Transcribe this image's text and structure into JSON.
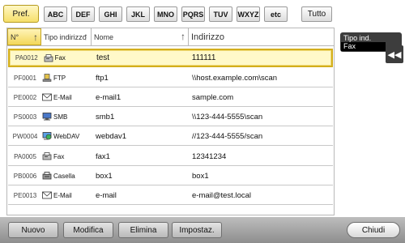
{
  "index_bar": {
    "pref_label": "Pref.",
    "tabs": [
      "ABC",
      "DEF",
      "GHI",
      "JKL",
      "MNO",
      "PQRS",
      "TUV",
      "WXYZ",
      "etc"
    ],
    "all_label": "Tutto"
  },
  "table": {
    "headers": {
      "number": "N°",
      "type": "Tipo indirizzo",
      "name": "Nome",
      "address": "Indirizzo"
    },
    "rows": [
      {
        "number": "PA0012",
        "type": "Fax",
        "type_icon": "fax-icon",
        "name": "test",
        "address": "111111"
      },
      {
        "number": "PF0001",
        "type": "FTP",
        "type_icon": "ftp-icon",
        "name": "ftp1",
        "address": "\\\\host.example.com\\scan"
      },
      {
        "number": "PE0002",
        "type": "E-Mail",
        "type_icon": "email-icon",
        "name": "e-mail1",
        "address": "sample.com"
      },
      {
        "number": "PS0003",
        "type": "SMB",
        "type_icon": "smb-icon",
        "name": "smb1",
        "address": "\\\\123-444-5555\\scan"
      },
      {
        "number": "PW0004",
        "type": "WebDAV",
        "type_icon": "webdav-icon",
        "name": "webdav1",
        "address": "//123-444-5555/scan"
      },
      {
        "number": "PA0005",
        "type": "Fax",
        "type_icon": "fax-icon",
        "name": "fax1",
        "address": "12341234"
      },
      {
        "number": "PB0006",
        "type": "Casella",
        "type_icon": "box-icon",
        "name": "box1",
        "address": "box1"
      },
      {
        "number": "PE0013",
        "type": "E-Mail",
        "type_icon": "email-icon",
        "name": "e-mail",
        "address": "e-mail@test.local"
      }
    ],
    "selected_index": 0
  },
  "side_panel": {
    "label": "Tipo ind.",
    "value": "Fax",
    "collapse_glyph": "◀◀"
  },
  "bottom_bar": {
    "new_label": "Nuovo",
    "edit_label": "Modifica",
    "delete_label": "Elimina",
    "settings_label": "Impostaz.",
    "close_label": "Chiudi"
  },
  "colors": {
    "selection_border": "#d3ae1c",
    "selection_fill": "#fff9c9",
    "panel_dark": "#3d3d3d"
  }
}
